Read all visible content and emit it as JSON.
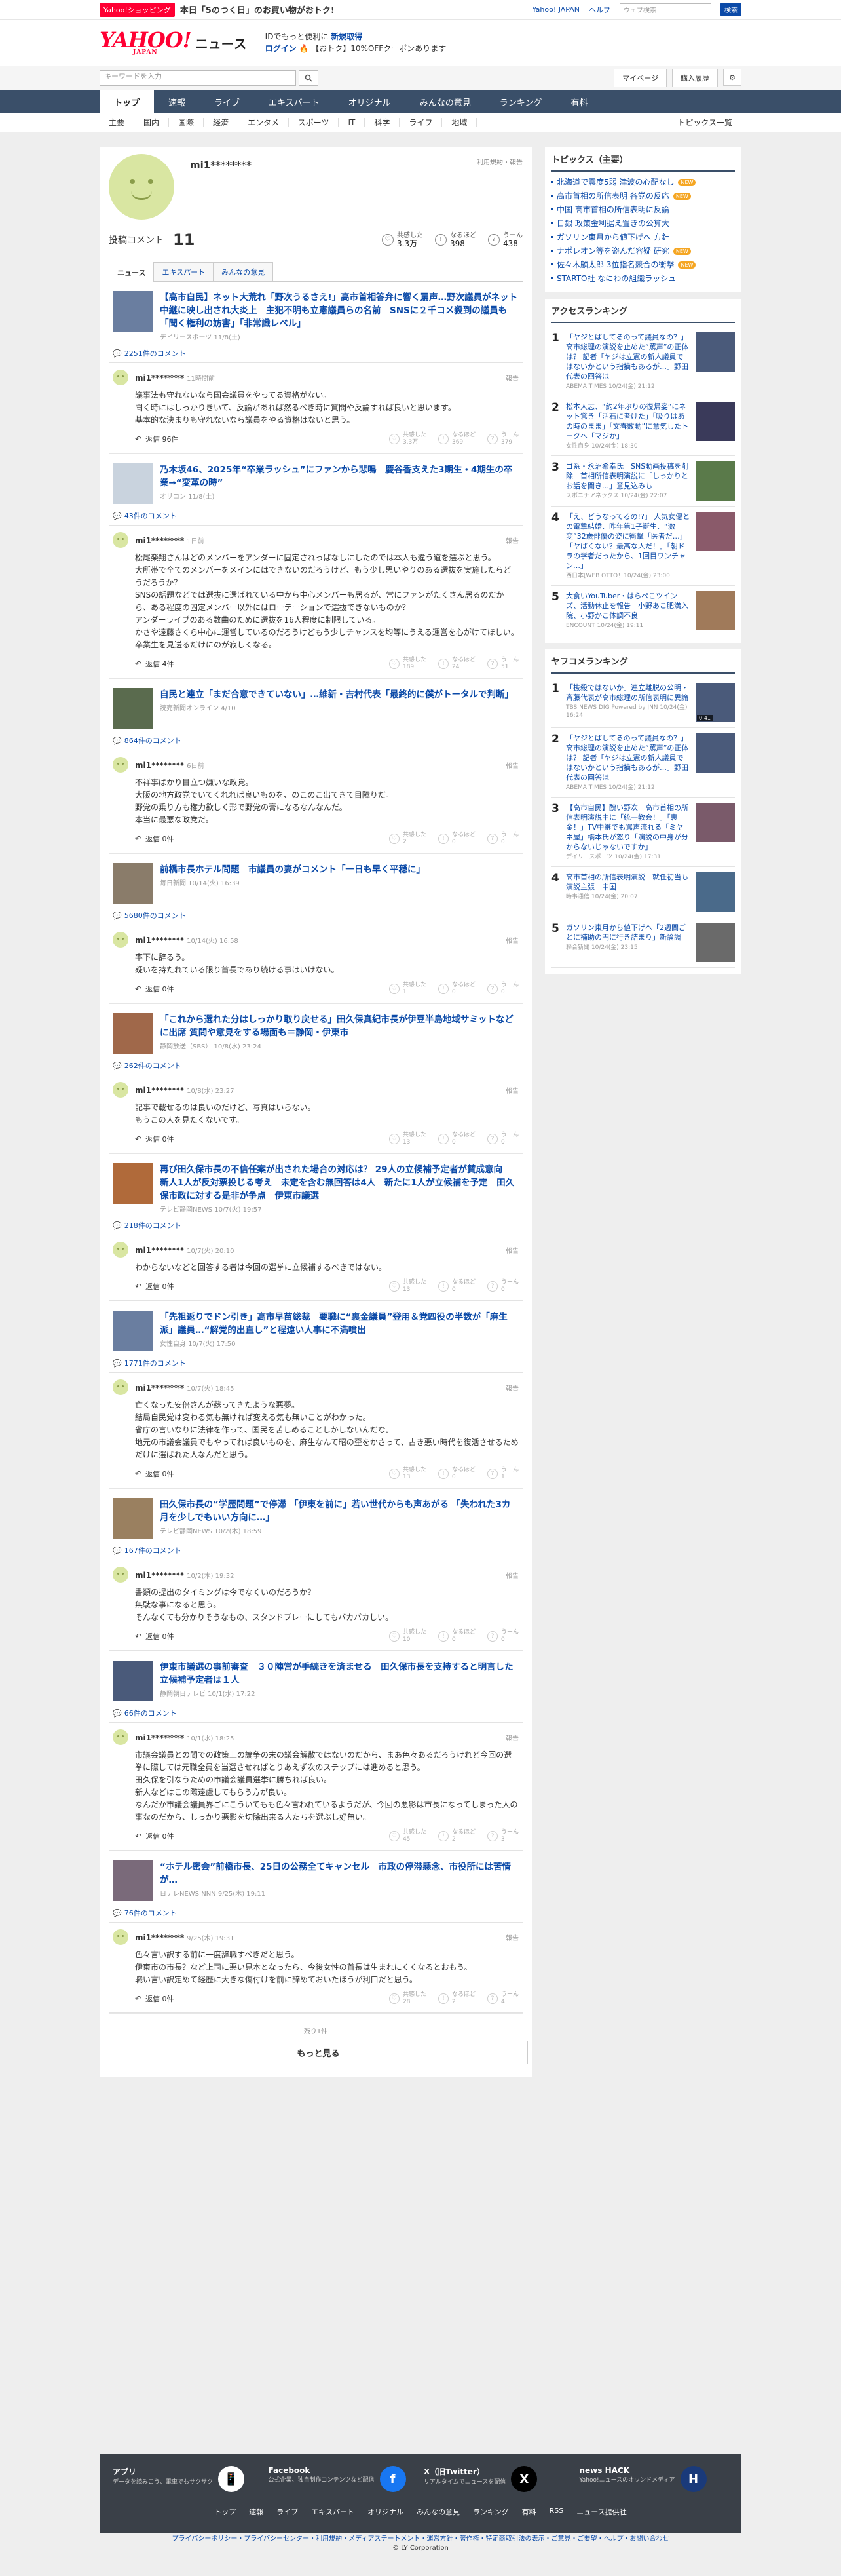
{
  "topbar": {
    "shopping_badge": "Yahoo!ショッピング",
    "promo": "本日「5のつく日」のお買い物がおトク!",
    "links": [
      "Yahoo! JAPAN",
      "ヘルプ"
    ],
    "search_placeholder": "ウェブ検索",
    "search_btn": "検索"
  },
  "header": {
    "logo": "YAHOO!",
    "logo_sub": "JAPAN",
    "service": "ニュース",
    "line1": "IDでもっと便利に",
    "line1b": "新規取得",
    "line2": "ログイン",
    "line2b": "【おトク】10%OFFクーポンあります"
  },
  "search": {
    "placeholder": "キーワードを入力",
    "mypage": "マイページ",
    "purchase": "購入履歴"
  },
  "nav1": [
    "トップ",
    "速報",
    "ライブ",
    "エキスパート",
    "オリジナル",
    "みんなの意見",
    "ランキング",
    "有料"
  ],
  "nav2": [
    "主要",
    "国内",
    "国際",
    "経済",
    "エンタメ",
    "スポーツ",
    "IT",
    "科学",
    "ライフ",
    "地域"
  ],
  "nav2_right": "トピックス一覧",
  "profile": {
    "name": "mi1********",
    "links": "利用規約・報告",
    "count_label": "投稿コメント",
    "count": "11",
    "rx": [
      {
        "label": "共感した",
        "value": "3.3万"
      },
      {
        "label": "なるほど",
        "value": "398"
      },
      {
        "label": "うーん",
        "value": "438"
      }
    ],
    "tabs": [
      "ニュース",
      "エキスパート",
      "みんなの意見"
    ]
  },
  "items": [
    {
      "title": "【高市自民】ネット大荒れ「野次うるさえ!」高市首相答弁に響く罵声…野次議員がネット中継に映し出され大炎上　主犯不明も立憲議員らの名前　SNSに２千コメ殺到の議員も「聞く権利の妨害」「非常識レベル」",
      "source": "デイリースポーツ 11/8(土)",
      "count": "2251件のコメント",
      "time": "11時間前",
      "body": "議事法も守れないなら国会議員をやってる資格がない。\n聞く時にはしっかりきいて、反論があれば然るべき時に質問や反論すれば良いと思います。\n基本的な決まりも守れないなら議員をやる資格はないと思う。",
      "replies": "返信 96件",
      "r": [
        "3.3万",
        "369",
        "379"
      ],
      "thumb": "#6a7ea0"
    },
    {
      "title": "乃木坂46、2025年“卒業ラッシュ”にファンから悲鳴　慶谷香支えた3期生・4期生の卒業→“変革の時”",
      "source": "オリコン 11/8(土)",
      "count": "43件のコメント",
      "time": "1日前",
      "body": "松尾楽翔さんはどのメンバーをアンダーに固定されっぱなしにしたのでは本人も違う道を選ぶと思う。\n大所帯で全てのメンバーをメインにはできないのだろうけど、もう少し思いやりのある選抜を実施したらどうだろうか？\nSNSの話題などでは選抜に選ばれている中から中心メンバーも居るが、常にファンがたくさん居るのだから、ある程度の固定メンバー以外にはローテーションで選抜できないものか？\nアンダーライブのある数曲のために選抜を16人程度に制限している。\nかさや遠藤さくら中心に運営しているのだろうけどもう少しチャンスを均等にうえる運営を心がけてほしい。\n卒業生を見送るだけにのが寂しくなる。",
      "replies": "返信 4件",
      "r": [
        "189",
        "24",
        "51"
      ],
      "thumb": "#c9d3de"
    },
    {
      "title": "自民と連立「まだ合意できていない」…維新・吉村代表「最終的に僕がトータルで判断」",
      "source": "読売新聞オンライン 4/10",
      "count": "864件のコメント",
      "time": "6日前",
      "body": "不祥事ばかり目立つ嫌いな政党。\n大阪の地方政党でいてくれれば良いものを、のこのこ出てきて目障りだ。\n野党の乗り方も権力欲しく形で野党の膏になるなんなんだ。\n本当に最悪な政党だ。",
      "replies": "返信 0件",
      "r": [
        "2",
        "0",
        "0"
      ],
      "thumb": "#5a6b4e"
    },
    {
      "title": "前橋市長ホテル問題　市議員の妻がコメント「一日も早く平穏に」",
      "source": "毎日新聞 10/14(火) 16:39",
      "count": "5680件のコメント",
      "time": "10/14(火) 16:58",
      "body": "率下に辞るう。\n疑いを持たれている限り首長であり続ける事はいけない。",
      "replies": "返信 0件",
      "r": [
        "1",
        "0",
        "0"
      ],
      "thumb": "#8a7c6a"
    },
    {
      "title": "「これから選れた分はしっかり取り戻せる」田久保真紀市長が伊豆半島地域サミットなどに出席 質問や意見をする場面も＝静岡・伊東市",
      "source": "静岡放送（SBS） 10/8(水) 23:24",
      "count": "262件のコメント",
      "time": "10/8(水) 23:27",
      "body": "記事で載せるのは良いのだけど、写真はいらない。\nもうこの人を見たくないです。",
      "replies": "返信 0件",
      "r": [
        "13",
        "0",
        "0"
      ],
      "thumb": "#a0684a"
    },
    {
      "title": "再び田久保市長の不信任案が出された場合の対応は？ 29人の立候補予定者が賛成意向　新人1人が反対票投じる考え　未定を含む無回答は4人　新たに1人が立候補を予定　田久保市政に対する是非が争点　伊東市議選",
      "source": "テレビ静岡NEWS 10/7(火) 19:57",
      "count": "218件のコメント",
      "time": "10/7(火) 20:10",
      "body": "わからないなどと回答する者は今回の選挙に立候補するべきではない。",
      "replies": "返信 0件",
      "r": [
        "13",
        "0",
        "0"
      ],
      "thumb": "#b06a3a"
    },
    {
      "title": "「先祖返りでドン引き」高市早苗総裁　要職に“裏金議員”登用＆党四役の半数が「麻生派」議員…“解党的出直し”と程遠い人事に不満噴出",
      "source": "女性自身 10/7(火) 17:50",
      "count": "1771件のコメント",
      "time": "10/7(火) 18:45",
      "body": "亡くなった安倍さんが蘇ってきたような悪夢。\n結局自民党は変わる気も無ければ変える気も無いことがわかった。\n省庁の言いなりに法律を作って、国民を苦しめることしかしないんだな。\n地元の市議会議員でもやってれば良いものを、麻生なんて昭の歪をかさって、古き悪い時代を復活させるためだけに選ばれた人なんだと思う。",
      "replies": "返信 0件",
      "r": [
        "13",
        "0",
        "1"
      ],
      "thumb": "#6a7ea0"
    },
    {
      "title": "田久保市長の“学歴問題”で停滞 「伊東を前に」若い世代からも声あがる 「失われた3カ月を少しでもいい方向に…」",
      "source": "テレビ静岡NEWS 10/2(木) 18:59",
      "count": "167件のコメント",
      "time": "10/2(木) 19:32",
      "body": "書類の提出のタイミングは今でなくいのだろうか？\n無駄な事になると思う。\nそんなくても分かりそうなもの、スタンドプレーにしてもバカバカしい。",
      "replies": "返信 0件",
      "r": [
        "10",
        "0",
        "0"
      ],
      "thumb": "#9a8060"
    },
    {
      "title": "伊東市議選の事前審査　３０陣営が手続きを済ませる　田久保市長を支持すると明言した立候補予定者は１人",
      "source": "静岡朝日テレビ 10/1(水) 17:22",
      "count": "66件のコメント",
      "time": "10/1(水) 18:25",
      "body": "市議会議員との間での政策上の論争の末の議会解散ではないのだから、まあ色々あるだろうけれど今回の選挙に際しては元職全員を当選させればとりあえず次のステップには進めると思う。\n田久保を引なうための市議会議員選挙に勝ちれば良い。\n新人などはこの際遠慮してもらう方が良い。\nなんだか市議会議員界ごにこういてもも色々言われているようだが、今回の悪影は市長になってしまった人の事なのだから、しっかり悪影を切除出来る人たちを選ぶし好無い。",
      "replies": "返信 0件",
      "r": [
        "45",
        "2",
        "3"
      ],
      "thumb": "#4a5a7a"
    },
    {
      "title": "“ホテル密会”前橋市長、25日の公務全てキャンセル　市政の停滞懸念、市役所には苦情が…",
      "source": "日テレNEWS NNN 9/25(木) 19:11",
      "count": "76件のコメント",
      "time": "9/25(木) 19:31",
      "body": "色々言い訳する前に一度辞職すべきだと思う。\n伊東市の市長？など上司に悪い見本となったら、今後女性の首長は生まれにくくなるとおもう。\n職い言い訳定めて経歴に大きな傷付けを前に辞めておいたほうが利口だと思う。",
      "replies": "返信 0件",
      "r": [
        "28",
        "2",
        "4"
      ],
      "thumb": "#7a6a7a"
    }
  ],
  "remaining": "残り1件",
  "more": "もっと見る",
  "side": {
    "topics_title": "トピックス（主要）",
    "topics": [
      {
        "t": "北海道で震度5弱 津波の心配なし",
        "n": "NEW"
      },
      {
        "t": "高市首相の所信表明 各党の反応",
        "n": "NEW"
      },
      {
        "t": "中国 高市首相の所信表明に反論",
        "n": ""
      },
      {
        "t": "日銀 政策金利据え置きの公算大",
        "n": ""
      },
      {
        "t": "ガソリン東月から値下げへ 方針",
        "n": ""
      },
      {
        "t": "ナポレオン等を盗んだ容疑 研究",
        "n": "NEW"
      },
      {
        "t": "佐々木麟太郎 3位指名競合の衝撃",
        "n": "NEW"
      },
      {
        "t": "STARTO社 なにわの組織ラッシュ",
        "n": ""
      }
    ],
    "access_title": "アクセスランキング",
    "access": [
      {
        "t": "「ヤジとばしてるのって議員なの？」高市総理の演説を止めた“罵声”の正体は？ 記者「ヤジは立憲の新人議員ではないかという指摘もあるが…」野田代表の回答は",
        "s": "ABEMA TIMES 10/24(金) 21:12",
        "c": "#4a5a7a",
        "v": ""
      },
      {
        "t": "松本人志、“約2年ぶりの復帰姿”にネット驚き「活石に者けた」「吸りはあの時のまま」「文春敗動”に意気したトークへ「マジか」",
        "s": "女性自身 10/24(金) 18:30",
        "c": "#3a3a5a",
        "v": ""
      },
      {
        "t": "ゴ系・永沼希幸氏　SNS動画投稿を削除　首相所信表明演説に「しっかりとお話を聞き…」意見込みも",
        "s": "スポニチアネックス 10/24(金) 22:07",
        "c": "#5a7a4a",
        "v": ""
      },
      {
        "t": "「え、どうなってるの!?」 人気女優との電撃結婚、昨年第1子誕生、“激変”32歳俳優の姿に衝撃「医者だ…」「ヤばくない？最高な人だ！」「朝ドラの学者だったから、1回目ワンチャン…」",
        "s": "西日本[WEB OTTO！10/24(金) 23:00",
        "c": "#8a5a6a",
        "v": ""
      },
      {
        "t": "大食いYouTuber・はらぺこツインズ、活動休止を報告　小野あこ肥満入院、小野かこ体調不良",
        "s": "ENCOUNT 10/24(金) 19:11",
        "c": "#a07a5a",
        "v": ""
      }
    ],
    "yafoo_title": "ヤフコメランキング",
    "yafoo": [
      {
        "t": "「抜殺ではないか」連立離脱の公明・斉藤代表が高市総理の所信表明に異論",
        "s": "TBS NEWS DIG Powered by JNN 10/24(金) 16:24",
        "c": "#4a5a7a",
        "v": "0:41"
      },
      {
        "t": "「ヤジとばしてるのって議員なの？」高市総理の演説を止めた“罵声”の正体は？ 記者「ヤジは立憲の新人議員ではないかという指摘もあるが…」野田代表の回答は",
        "s": "ABEMA TIMES 10/24(金) 21:12",
        "c": "#4a5a7a",
        "v": ""
      },
      {
        "t": "【高市自民】醜い野次　高市首相の所信表明演説中に「統一教会！」「裏金！」TV中継でも罵声流れる「ミヤネ屋」橋本氏が怒り「演説の中身が分からないじゃないですか」",
        "s": "デイリースポーツ 10/24(金) 17:31",
        "c": "#7a5a6a",
        "v": ""
      },
      {
        "t": "高市首相の所信表明演説　就任初当も演説主張　中国",
        "s": "時事通信 10/24(金) 20:07",
        "c": "#4a6a8a",
        "v": ""
      },
      {
        "t": "ガソリン東月から値下げへ「2週間ごとに補助の円に行き詰まり」新論調",
        "s": "聯合新聞 10/24(金) 23:15",
        "c": "#6a6a6a",
        "v": ""
      }
    ]
  },
  "footer": {
    "apps": [
      {
        "t": "アプリ",
        "d": "データを読みこう、電車でもサクサク",
        "ic": "📱",
        "c": "#ffffff"
      },
      {
        "t": "Facebook",
        "d": "公式企業、独自制作コンテンツなど配信",
        "ic": "f",
        "c": "#1877f2"
      },
      {
        "t": "X（旧Twitter）",
        "d": "リアルタイムでニュースを配信",
        "ic": "X",
        "c": "#000000"
      },
      {
        "t": "news HACK",
        "d": "Yahoo!ニュースのオウンドメディア",
        "ic": "H",
        "c": "#1a3a7a"
      }
    ],
    "nav": [
      "トップ",
      "速報",
      "ライブ",
      "エキスパート",
      "オリジナル",
      "みんなの意見",
      "ランキング",
      "有料",
      "RSS",
      "ニュース提供社"
    ],
    "bottom": "プライバシーポリシー・プライバシーセンター・利用規約・メディアステートメント・運営方針・著作権・特定商取引法の表示・ご意見・ご要望・ヘルプ・お問い合わせ",
    "copyright": "© LY Corporation"
  }
}
